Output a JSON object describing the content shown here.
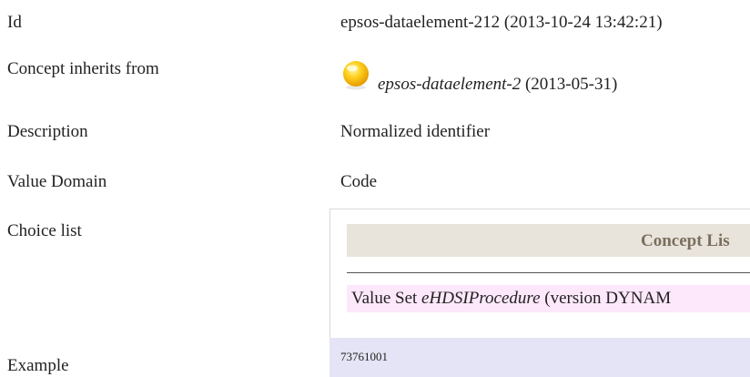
{
  "rows": {
    "id": {
      "label": "Id",
      "value": "epsos-dataelement-212 (2013-10-24 13:42:21)"
    },
    "inherits": {
      "label": "Concept inherits from",
      "icon": "yellow-circle-icon",
      "ref": "epsos-dataelement-2",
      "date": "(2013-05-31)"
    },
    "description": {
      "label": "Description",
      "value": "Normalized identifier"
    },
    "value_domain": {
      "label": "Value Domain",
      "value": "Code"
    },
    "choice_list": {
      "label": "Choice list",
      "concept_title": "Concept Lis",
      "valueset_prefix": "Value Set ",
      "valueset_name": "eHDSIProcedure",
      "valueset_suffix": " (version DYNAM"
    },
    "example": {
      "label": "Example",
      "value": "73761001"
    }
  },
  "colors": {
    "header_bg": "#e8e4dc",
    "valueset_bg": "#fde8fb",
    "example_bg": "#e4e4f6",
    "bulb": "#ffc107"
  }
}
